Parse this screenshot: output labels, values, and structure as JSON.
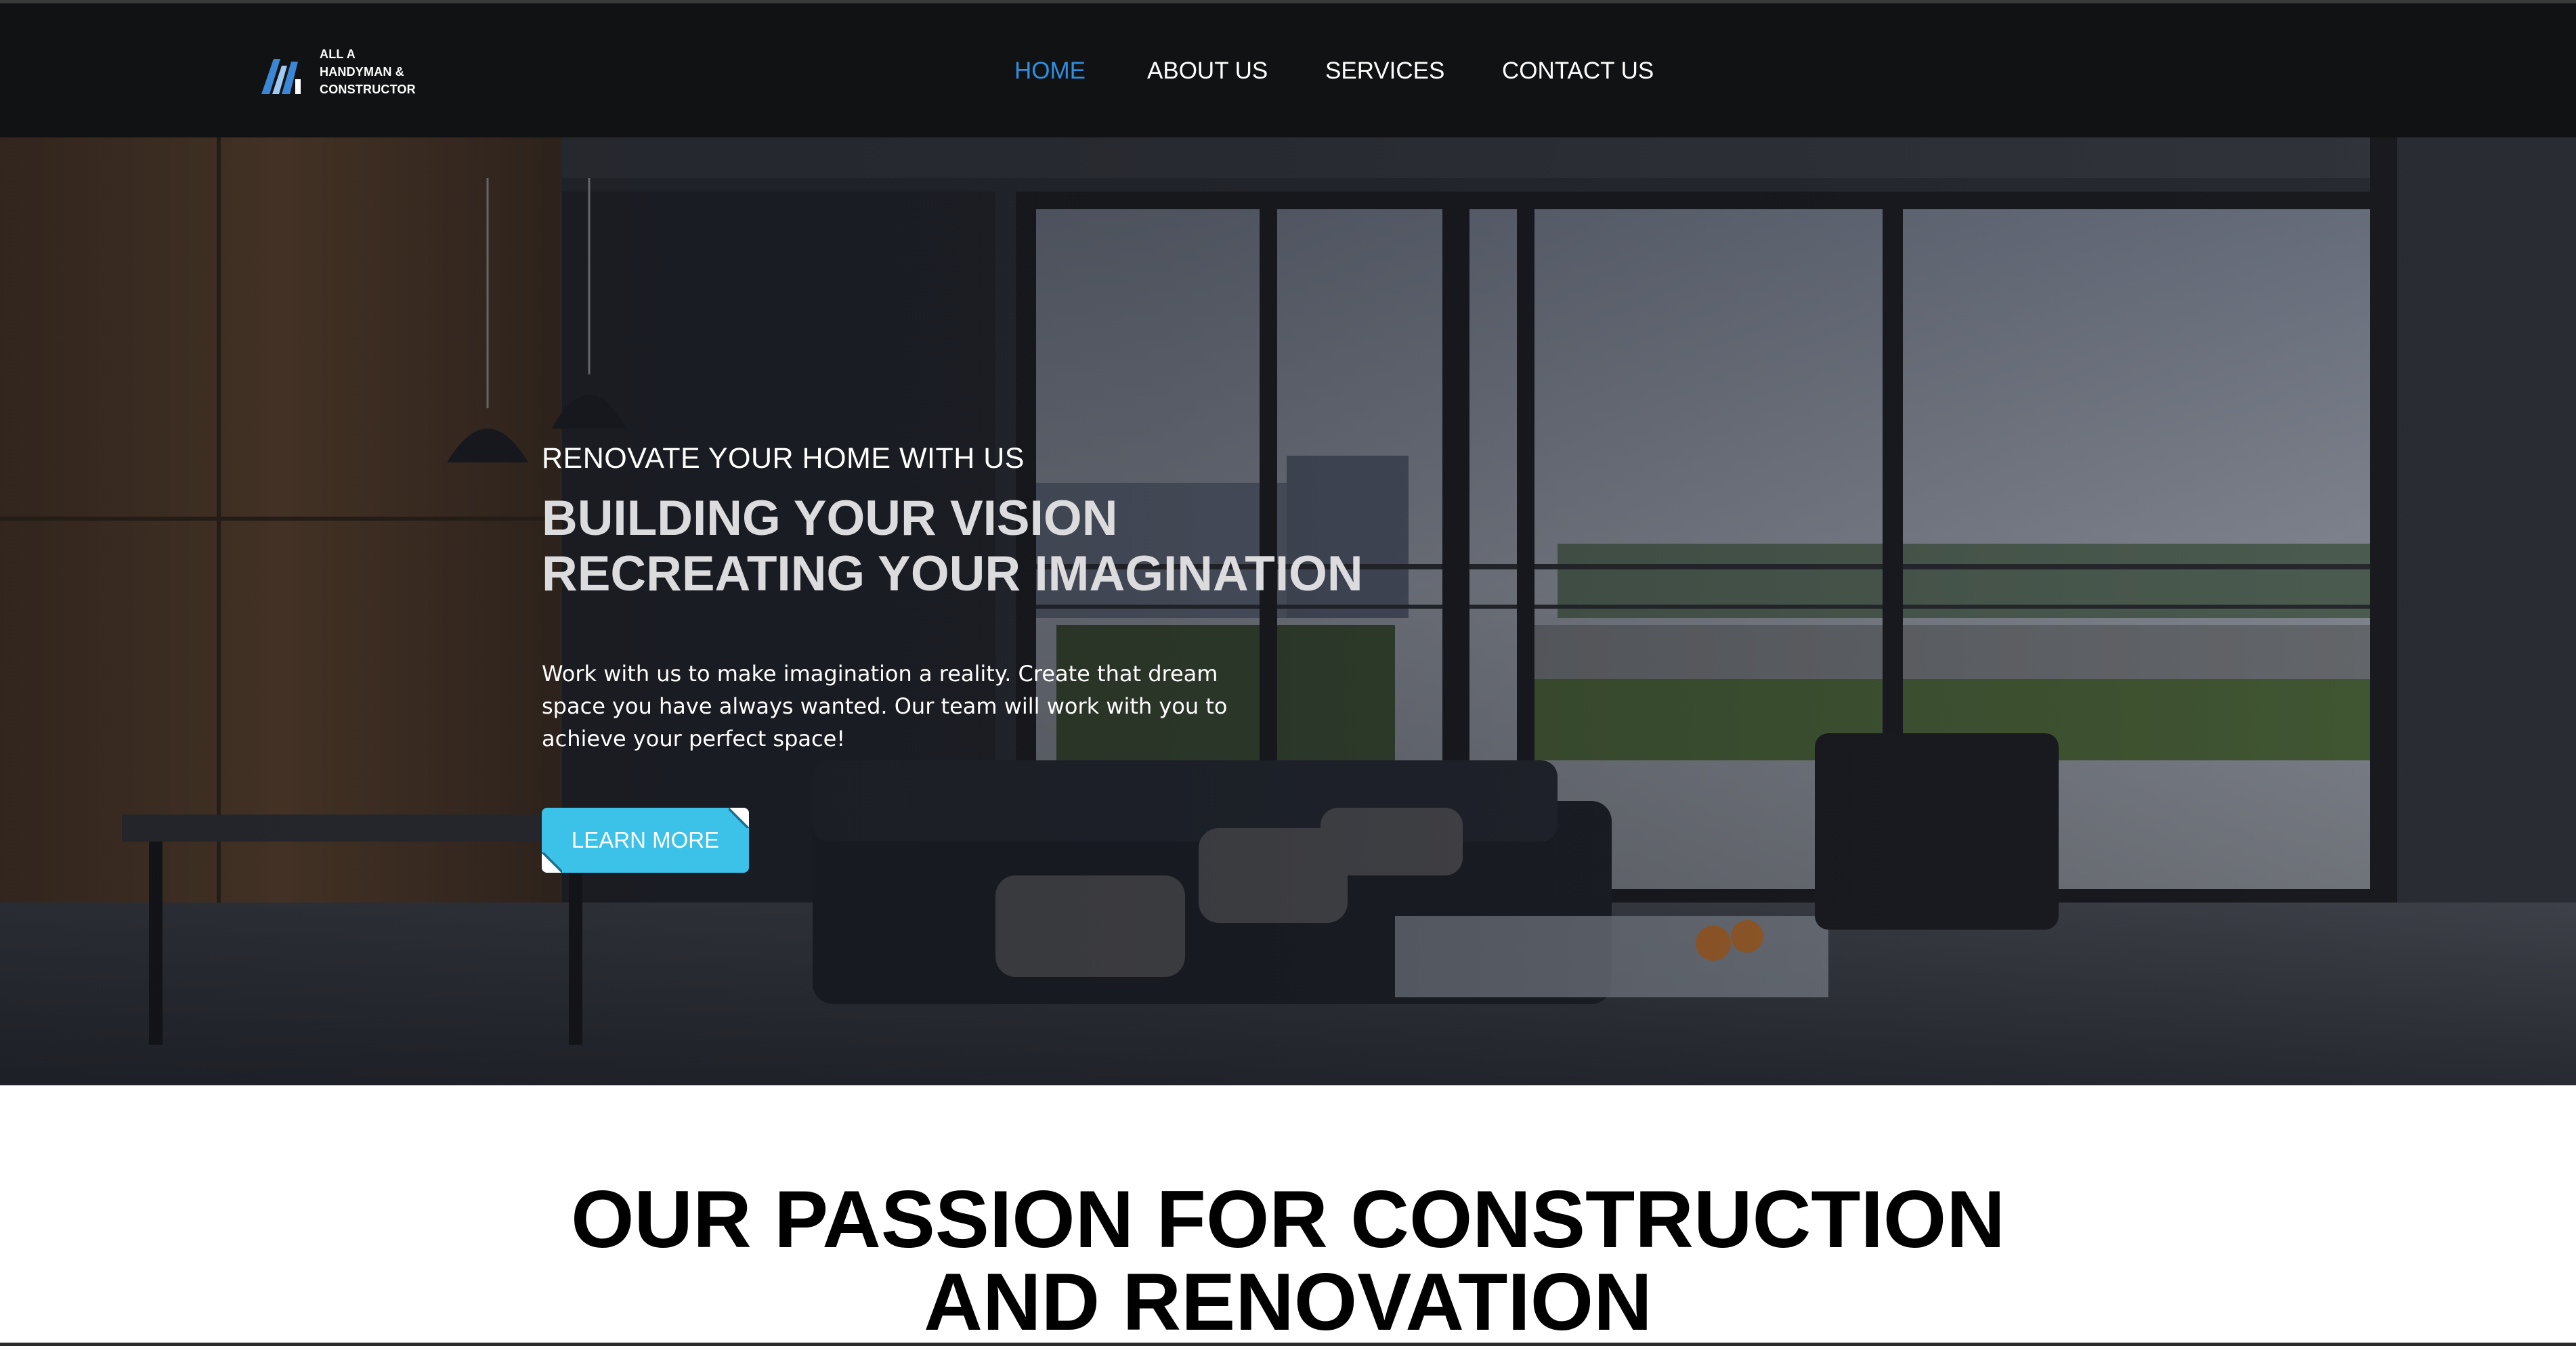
{
  "brand": {
    "logo_lines": [
      "ALL A",
      "HANDYMAN &",
      "CONSTRUCTOR"
    ],
    "logo_colors": {
      "blue": "#3c86d6",
      "light": "#9fc9f0",
      "white": "#ffffff"
    }
  },
  "nav": {
    "items": [
      {
        "label": "HOME",
        "active": true
      },
      {
        "label": "ABOUT US",
        "active": false
      },
      {
        "label": "SERVICES",
        "active": false
      },
      {
        "label": "CONTACT US",
        "active": false
      }
    ],
    "active_color": "#2f8fe0"
  },
  "hero": {
    "kicker": "RENOVATE YOUR HOME WITH US",
    "title_lines": [
      "BUILDING YOUR VISION",
      "RECREATING YOUR IMAGINATION"
    ],
    "description": "Work with us to make imagination a reality. Create that dream space you have always wanted. Our team will work with you to achieve your perfect space!",
    "button_label": "LEARN MORE",
    "button_color": "#3cc2e8"
  },
  "section": {
    "heading_lines": [
      "OUR PASSION FOR CONSTRUCTION",
      "AND RENOVATION"
    ]
  }
}
